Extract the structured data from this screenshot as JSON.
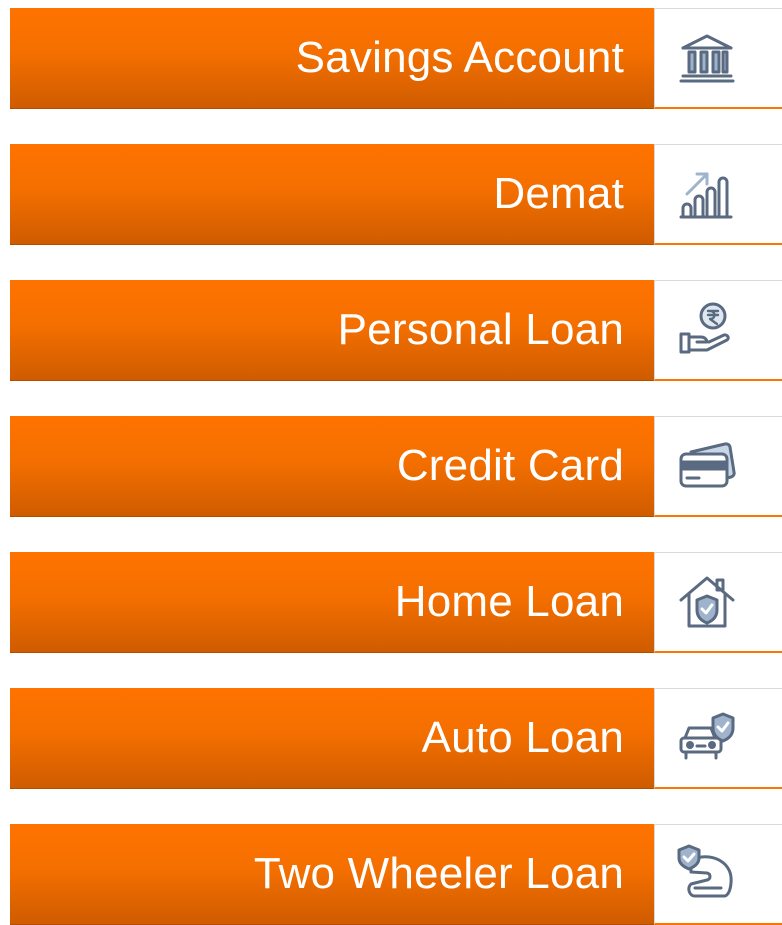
{
  "menu": {
    "items": [
      {
        "label": "Savings Account",
        "icon": "bank-icon"
      },
      {
        "label": "Demat",
        "icon": "growth-chart-icon"
      },
      {
        "label": "Personal Loan",
        "icon": "rupee-hand-icon"
      },
      {
        "label": "Credit Card",
        "icon": "credit-card-icon"
      },
      {
        "label": "Home Loan",
        "icon": "home-shield-icon"
      },
      {
        "label": "Auto Loan",
        "icon": "car-shield-icon"
      },
      {
        "label": "Two Wheeler Loan",
        "icon": "helmet-shield-icon"
      }
    ]
  },
  "colors": {
    "accent": "#ff7300",
    "accent_dark": "#cf5c00",
    "label_text": "#ffffff",
    "icon_stroke": "#5a6a80",
    "icon_fill": "#9fb3cc"
  }
}
